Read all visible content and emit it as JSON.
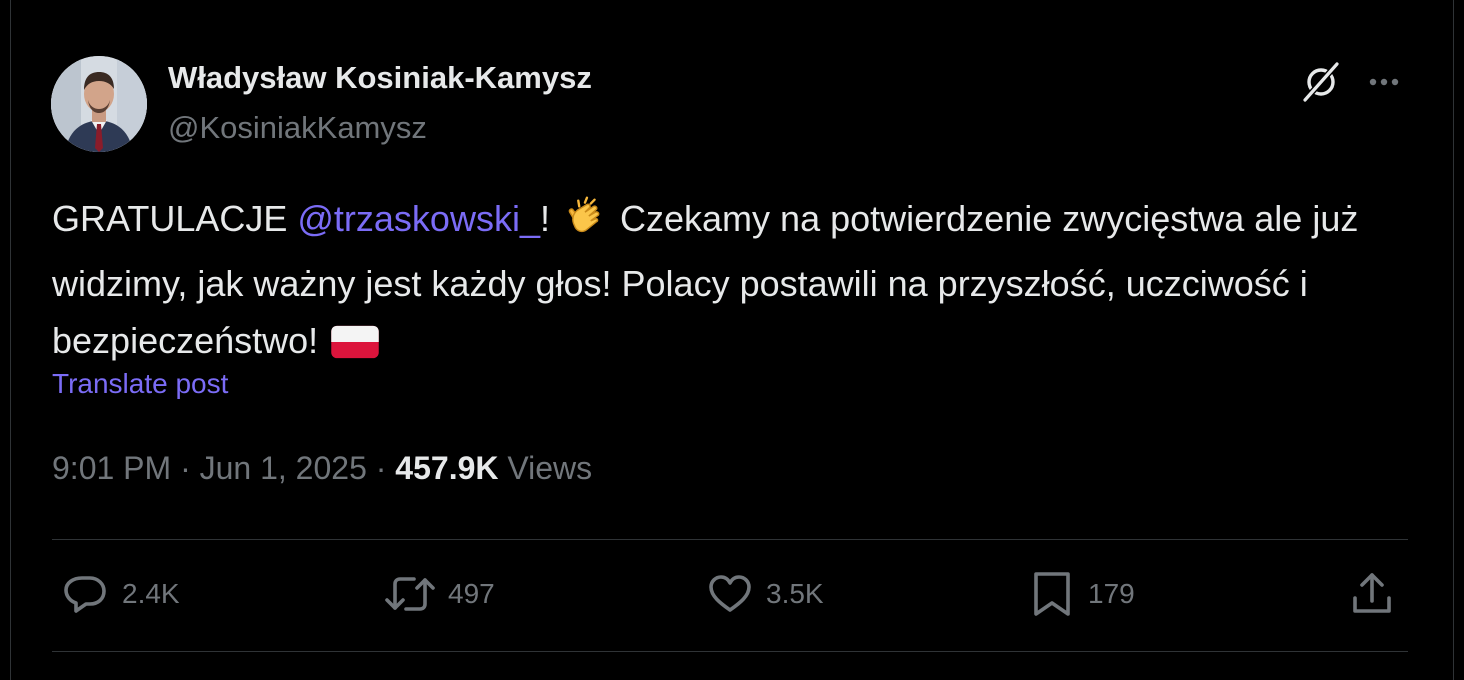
{
  "author": {
    "name": "Władysław Kosiniak-Kamysz",
    "handle": "@KosiniakKamysz"
  },
  "tweet": {
    "text_before_mention": "GRATULACJE ",
    "mention": "@trzaskowski_",
    "text_after_mention": "!",
    "clap_emoji": "👏",
    "text_main": " Czekamy na potwierdzenie zwycięstwa ale już widzimy, jak ważny jest każdy głos! Polacy postawili na przyszłość, uczciwość i bezpieczeństwo! ",
    "flag_emoji": "🇵🇱"
  },
  "translate_label": "Translate post",
  "meta": {
    "time": "9:01 PM",
    "separator": " · ",
    "date": "Jun 1, 2025",
    "views_count": "457.9K",
    "views_label": " Views"
  },
  "actions": {
    "replies": "2.4K",
    "reposts": "497",
    "likes": "3.5K",
    "bookmarks": "179"
  },
  "icons": {
    "grok": "grok-icon",
    "more": "more-icon",
    "reply": "reply-icon",
    "repost": "repost-icon",
    "like": "heart-icon",
    "bookmark": "bookmark-icon",
    "share": "share-icon"
  },
  "colors": {
    "background": "#000000",
    "text": "#e7e9ea",
    "muted": "#71767b",
    "accent": "#7b6cf6",
    "divider": "#2f3336"
  }
}
